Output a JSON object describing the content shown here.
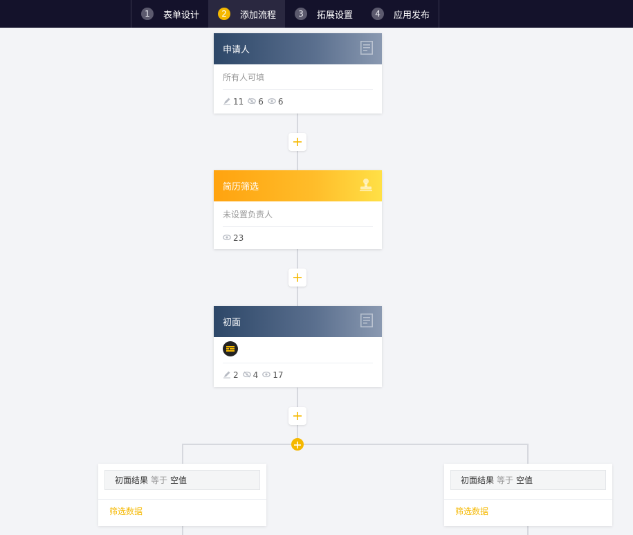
{
  "steps": [
    {
      "num": "1",
      "label": "表单设计",
      "active": false
    },
    {
      "num": "2",
      "label": "添加流程",
      "active": true
    },
    {
      "num": "3",
      "label": "拓展设置",
      "active": false
    },
    {
      "num": "4",
      "label": "应用发布",
      "active": false
    }
  ],
  "nodes": [
    {
      "title": "申请人",
      "desc": "所有人可填",
      "stats": {
        "edit": "11",
        "hidden": "6",
        "view": "6"
      }
    },
    {
      "title": "简历筛选",
      "desc": "未设置负责人",
      "stats": {
        "view": "23"
      }
    },
    {
      "title": "初面",
      "stats": {
        "edit": "2",
        "hidden": "4",
        "view": "17"
      }
    }
  ],
  "conditions": [
    {
      "field": "初面结果",
      "operator": "等于",
      "value": "空值",
      "link": "筛选数据"
    },
    {
      "field": "初面结果",
      "operator": "等于",
      "value": "空值",
      "link": "筛选数据"
    }
  ],
  "colors": {
    "topbar": "#14122b",
    "accent": "#f5b800",
    "node_dark": "#2d4768",
    "node_orange": "#ffa30f"
  },
  "icons": {
    "form_node": "form-icon",
    "approver_node": "stamp-icon",
    "add": "plus-icon",
    "edit": "pencil-icon",
    "hidden": "eye-slash-icon",
    "view": "eye-icon"
  }
}
